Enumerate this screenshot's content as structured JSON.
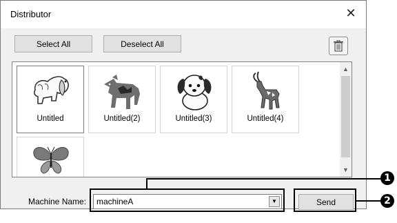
{
  "window": {
    "title": "Distributor",
    "close_glyph": "✕"
  },
  "toolbar": {
    "select_all_label": "Select All",
    "deselect_all_label": "Deselect All",
    "trash_icon": "trash-icon"
  },
  "designs": [
    {
      "label": "Untitled",
      "icon": "spaniel-dog-icon",
      "selected": true
    },
    {
      "label": "Untitled(2)",
      "icon": "horse-icon",
      "selected": false
    },
    {
      "label": "Untitled(3)",
      "icon": "puppy-icon",
      "selected": false
    },
    {
      "label": "Untitled(4)",
      "icon": "antelope-icon",
      "selected": false
    },
    {
      "label": "",
      "icon": "butterfly-icon",
      "selected": false
    }
  ],
  "machine": {
    "label": "Machine Name:",
    "value": "machineA"
  },
  "send_label": "Send",
  "callouts": {
    "one": "1",
    "two": "2"
  },
  "colors": {
    "window_bg": "#f0f0f0",
    "button_bg": "#e1e1e1",
    "horse": "#6e6e6e",
    "horse_accent": "#2a2a2a"
  }
}
